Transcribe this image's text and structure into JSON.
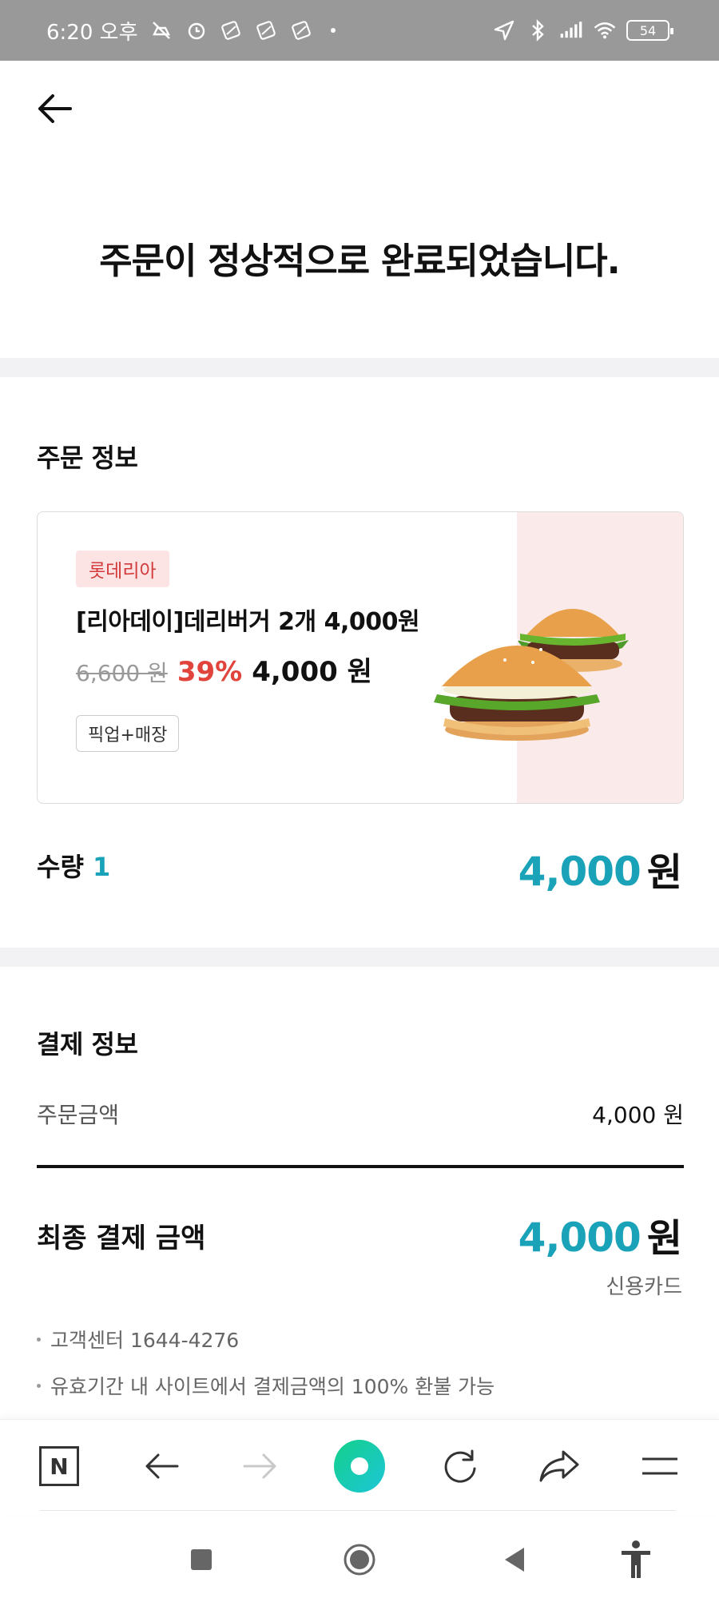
{
  "status_bar": {
    "time": "6:20 오후",
    "battery": "54",
    "icons": [
      "silent-icon",
      "alarm-icon",
      "notification-icon",
      "location-icon",
      "bluetooth-icon",
      "signal-icon",
      "wifi-icon",
      "battery-icon"
    ]
  },
  "header": {
    "back_icon": "arrow-left-icon"
  },
  "completion_message": "주문이 정상적으로 완료되었습니다.",
  "order_info": {
    "section_title": "주문 정보",
    "product": {
      "brand": "롯데리아",
      "name": "[리아데이]데리버거 2개 4,000원",
      "original_price": "6,600 원",
      "discount": "39%",
      "sale_price": "4,000 원",
      "tag": "픽업+매장",
      "image": "burger-image"
    },
    "quantity_label": "수량",
    "quantity_value": "1",
    "total_number": "4,000",
    "total_unit": "원"
  },
  "payment_info": {
    "section_title": "결제 정보",
    "order_amount_label": "주문금액",
    "order_amount_value": "4,000 원",
    "final_label": "최종 결제 금액",
    "final_number": "4,000",
    "final_unit": "원",
    "method": "신용카드",
    "notes": [
      "고객센터 1644-4276",
      "유효기간 내 사이트에서 결제금액의 100% 환불 가능"
    ]
  },
  "browser_toolbar": {
    "n_label": "N",
    "icons": [
      "naver-n-icon",
      "back-icon",
      "forward-icon",
      "home-green-icon",
      "reload-icon",
      "share-icon",
      "menu-icon"
    ]
  },
  "system_nav": {
    "icons": [
      "recents-icon",
      "home-icon",
      "back-triangle-icon",
      "accessibility-icon"
    ]
  },
  "colors": {
    "accent": "#1aa3b8",
    "discount": "#e0443b",
    "brand_badge_bg": "#fce4e4",
    "brand_badge_text": "#d33a3a"
  }
}
